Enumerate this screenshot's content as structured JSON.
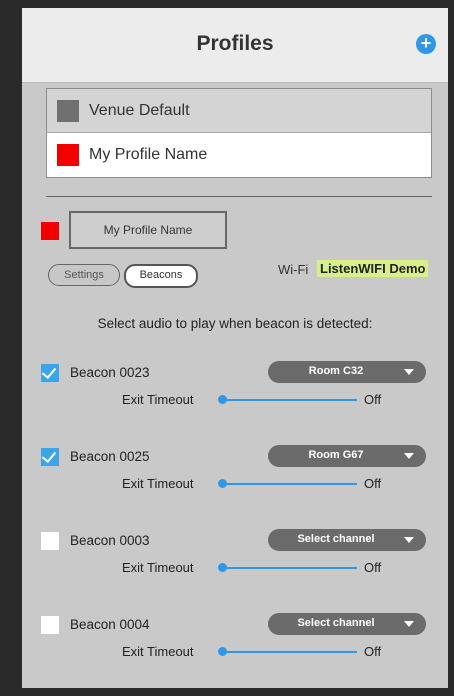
{
  "header": {
    "title": "Profiles",
    "add_icon": "plus-circle-icon"
  },
  "profiles": [
    {
      "label": "Venue Default",
      "color": "#707070"
    },
    {
      "label": "My Profile Name",
      "color": "#f40000"
    }
  ],
  "editor": {
    "color": "#f40000",
    "name_value": "My Profile Name",
    "tabs": {
      "settings": "Settings",
      "beacons": "Beacons"
    },
    "wifi_label": "Wi-Fi",
    "wifi_name": "ListenWIFI Demo"
  },
  "instructions": "Select audio to play when beacon is detected:",
  "beacons": [
    {
      "label": "Beacon 0023",
      "checked": true,
      "channel": "Room C32",
      "exit_label": "Exit Timeout",
      "timeout": "Off"
    },
    {
      "label": "Beacon 0025",
      "checked": true,
      "channel": "Room G67",
      "exit_label": "Exit Timeout",
      "timeout": "Off"
    },
    {
      "label": "Beacon 0003",
      "checked": false,
      "channel": "Select channel",
      "exit_label": "Exit Timeout",
      "timeout": "Off"
    },
    {
      "label": "Beacon 0004",
      "checked": false,
      "channel": "Select channel",
      "exit_label": "Exit Timeout",
      "timeout": "Off"
    }
  ]
}
